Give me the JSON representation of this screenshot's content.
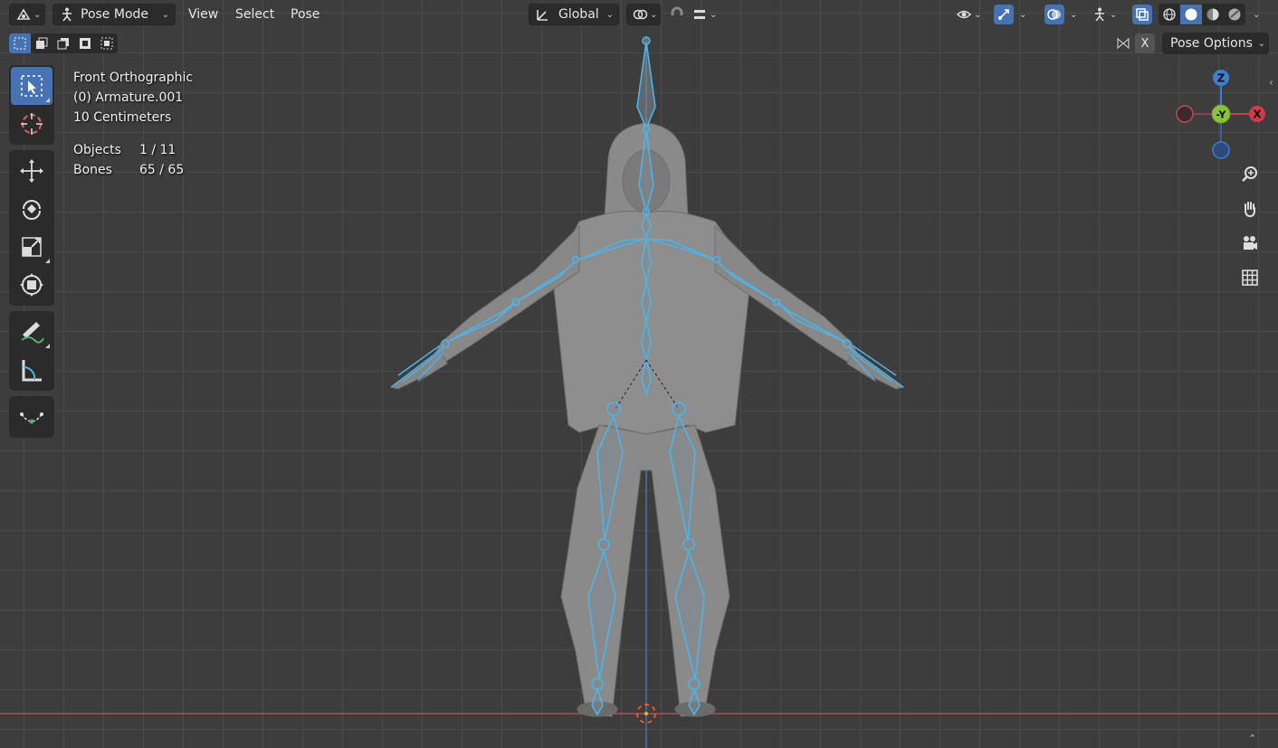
{
  "header": {
    "mode_label": "Pose Mode",
    "menus": [
      "View",
      "Select",
      "Pose"
    ],
    "orientation_label": "Global"
  },
  "overlay": {
    "view_name": "Front Orthographic",
    "object_name": "(0) Armature.001",
    "scale_label": "10 Centimeters",
    "objects_key": "Objects",
    "objects_value": "1 / 11",
    "bones_key": "Bones",
    "bones_value": "65 / 65"
  },
  "right": {
    "pose_options_label": "Pose Options",
    "x_mirror_label": "X"
  },
  "gizmo": {
    "z_label": "Z",
    "y_label": "-Y",
    "x_label": "X"
  },
  "colors": {
    "accent": "#4772b3",
    "bone_outline": "#4fb3e8",
    "x_axis": "#d13a4a",
    "y_axis": "#8bc23c",
    "z_axis": "#3e7fd1"
  }
}
